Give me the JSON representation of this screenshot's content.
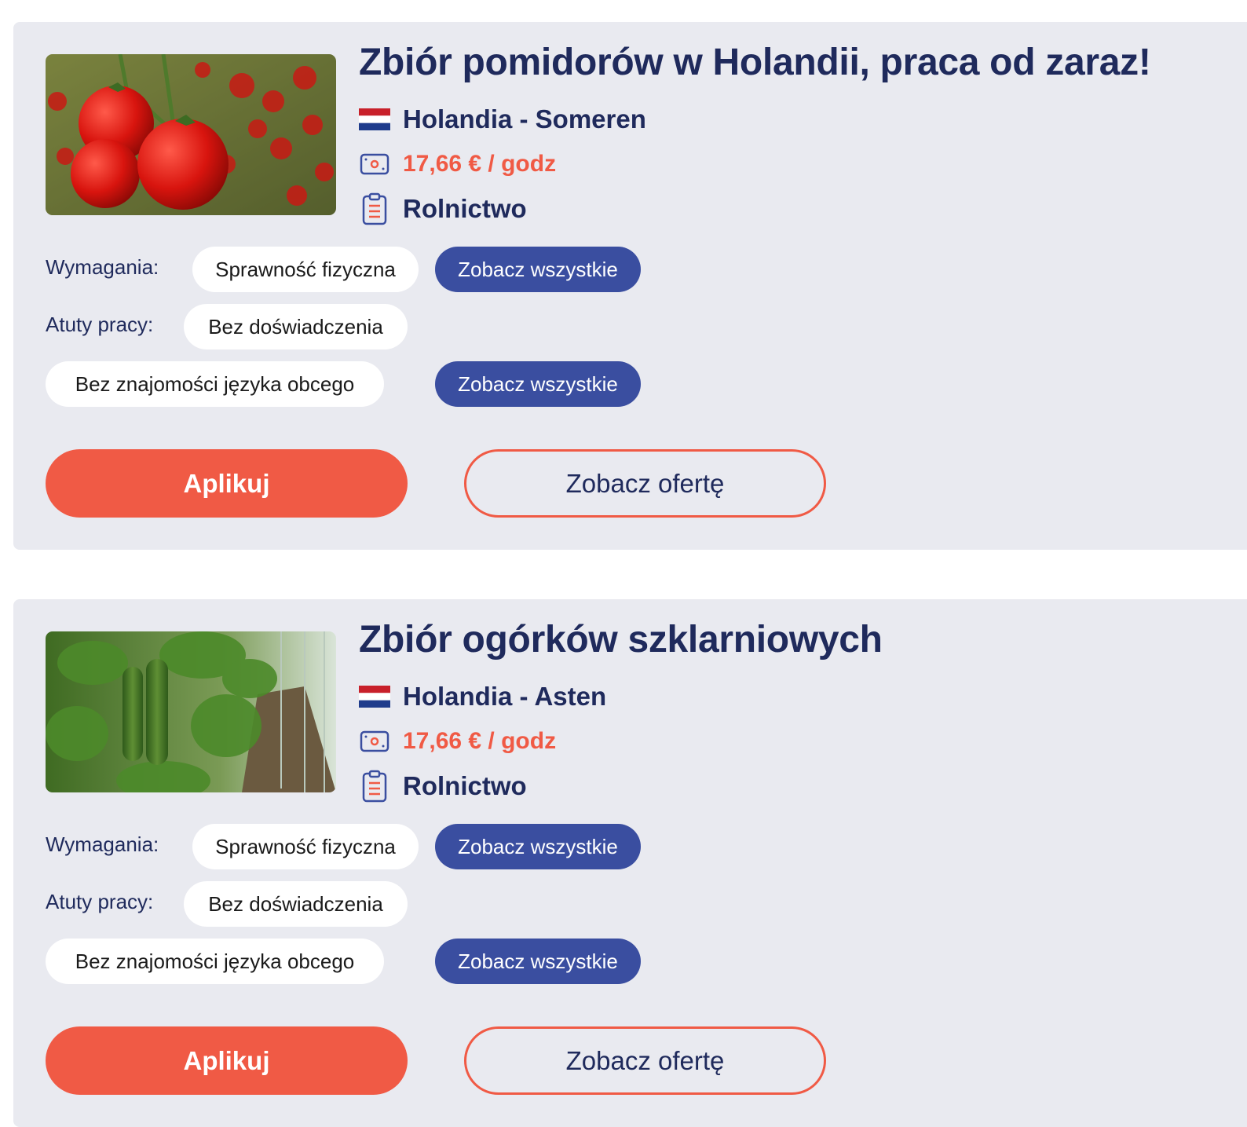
{
  "offers": [
    {
      "title": "Zbiór pomidorów w Holandii, praca od zaraz!",
      "image": "tomatoes-photo",
      "location": "Holandia - Someren",
      "salary": "17,66 € / godz",
      "category": "Rolnictwo",
      "requirements_label": "Wymagania:",
      "requirements": [
        "Sprawność fizyczna"
      ],
      "benefits_label": "Atuty pracy:",
      "benefits": [
        "Bez doświadczenia",
        "Bez znajomości języka obcego"
      ],
      "see_all_label": "Zobacz wszystkie",
      "apply_label": "Aplikuj",
      "view_offer_label": "Zobacz ofertę"
    },
    {
      "title": "Zbiór ogórków szklarniowych",
      "image": "cucumbers-greenhouse-photo",
      "location": "Holandia - Asten",
      "salary": "17,66 € / godz",
      "category": "Rolnictwo",
      "requirements_label": "Wymagania:",
      "requirements": [
        "Sprawność fizyczna"
      ],
      "benefits_label": "Atuty pracy:",
      "benefits": [
        "Bez doświadczenia",
        "Bez znajomości języka obcego"
      ],
      "see_all_label": "Zobacz wszystkie",
      "apply_label": "Aplikuj",
      "view_offer_label": "Zobacz ofertę"
    }
  ],
  "colors": {
    "navy": "#1f2a5c",
    "accent": "#f05a45",
    "chip_blue": "#3a4ea0",
    "card_bg": "#e9eaf0"
  },
  "icons": [
    "netherlands-flag-icon",
    "money-icon",
    "clipboard-icon"
  ]
}
